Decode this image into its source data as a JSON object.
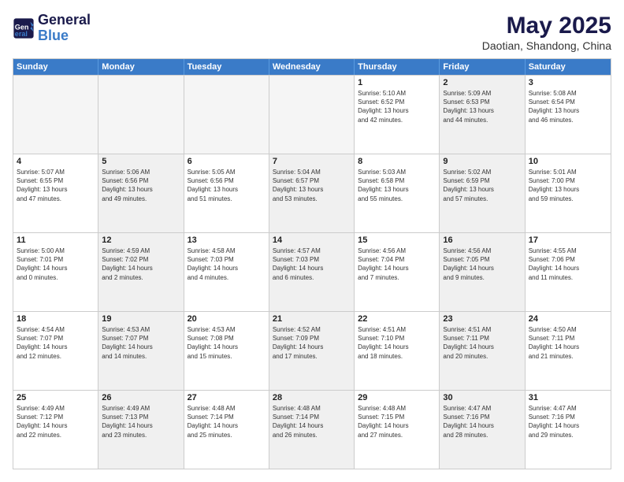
{
  "logo": {
    "line1": "General",
    "line2": "Blue"
  },
  "title": "May 2025",
  "subtitle": "Daotian, Shandong, China",
  "days": [
    "Sunday",
    "Monday",
    "Tuesday",
    "Wednesday",
    "Thursday",
    "Friday",
    "Saturday"
  ],
  "rows": [
    [
      {
        "day": "",
        "empty": true,
        "shaded": false
      },
      {
        "day": "",
        "empty": true,
        "shaded": false
      },
      {
        "day": "",
        "empty": true,
        "shaded": false
      },
      {
        "day": "",
        "empty": true,
        "shaded": false
      },
      {
        "day": "1",
        "empty": false,
        "shaded": false,
        "info": "Sunrise: 5:10 AM\nSunset: 6:52 PM\nDaylight: 13 hours\nand 42 minutes."
      },
      {
        "day": "2",
        "empty": false,
        "shaded": true,
        "info": "Sunrise: 5:09 AM\nSunset: 6:53 PM\nDaylight: 13 hours\nand 44 minutes."
      },
      {
        "day": "3",
        "empty": false,
        "shaded": false,
        "info": "Sunrise: 5:08 AM\nSunset: 6:54 PM\nDaylight: 13 hours\nand 46 minutes."
      }
    ],
    [
      {
        "day": "4",
        "empty": false,
        "shaded": false,
        "info": "Sunrise: 5:07 AM\nSunset: 6:55 PM\nDaylight: 13 hours\nand 47 minutes."
      },
      {
        "day": "5",
        "empty": false,
        "shaded": true,
        "info": "Sunrise: 5:06 AM\nSunset: 6:56 PM\nDaylight: 13 hours\nand 49 minutes."
      },
      {
        "day": "6",
        "empty": false,
        "shaded": false,
        "info": "Sunrise: 5:05 AM\nSunset: 6:56 PM\nDaylight: 13 hours\nand 51 minutes."
      },
      {
        "day": "7",
        "empty": false,
        "shaded": true,
        "info": "Sunrise: 5:04 AM\nSunset: 6:57 PM\nDaylight: 13 hours\nand 53 minutes."
      },
      {
        "day": "8",
        "empty": false,
        "shaded": false,
        "info": "Sunrise: 5:03 AM\nSunset: 6:58 PM\nDaylight: 13 hours\nand 55 minutes."
      },
      {
        "day": "9",
        "empty": false,
        "shaded": true,
        "info": "Sunrise: 5:02 AM\nSunset: 6:59 PM\nDaylight: 13 hours\nand 57 minutes."
      },
      {
        "day": "10",
        "empty": false,
        "shaded": false,
        "info": "Sunrise: 5:01 AM\nSunset: 7:00 PM\nDaylight: 13 hours\nand 59 minutes."
      }
    ],
    [
      {
        "day": "11",
        "empty": false,
        "shaded": false,
        "info": "Sunrise: 5:00 AM\nSunset: 7:01 PM\nDaylight: 14 hours\nand 0 minutes."
      },
      {
        "day": "12",
        "empty": false,
        "shaded": true,
        "info": "Sunrise: 4:59 AM\nSunset: 7:02 PM\nDaylight: 14 hours\nand 2 minutes."
      },
      {
        "day": "13",
        "empty": false,
        "shaded": false,
        "info": "Sunrise: 4:58 AM\nSunset: 7:03 PM\nDaylight: 14 hours\nand 4 minutes."
      },
      {
        "day": "14",
        "empty": false,
        "shaded": true,
        "info": "Sunrise: 4:57 AM\nSunset: 7:03 PM\nDaylight: 14 hours\nand 6 minutes."
      },
      {
        "day": "15",
        "empty": false,
        "shaded": false,
        "info": "Sunrise: 4:56 AM\nSunset: 7:04 PM\nDaylight: 14 hours\nand 7 minutes."
      },
      {
        "day": "16",
        "empty": false,
        "shaded": true,
        "info": "Sunrise: 4:56 AM\nSunset: 7:05 PM\nDaylight: 14 hours\nand 9 minutes."
      },
      {
        "day": "17",
        "empty": false,
        "shaded": false,
        "info": "Sunrise: 4:55 AM\nSunset: 7:06 PM\nDaylight: 14 hours\nand 11 minutes."
      }
    ],
    [
      {
        "day": "18",
        "empty": false,
        "shaded": false,
        "info": "Sunrise: 4:54 AM\nSunset: 7:07 PM\nDaylight: 14 hours\nand 12 minutes."
      },
      {
        "day": "19",
        "empty": false,
        "shaded": true,
        "info": "Sunrise: 4:53 AM\nSunset: 7:07 PM\nDaylight: 14 hours\nand 14 minutes."
      },
      {
        "day": "20",
        "empty": false,
        "shaded": false,
        "info": "Sunrise: 4:53 AM\nSunset: 7:08 PM\nDaylight: 14 hours\nand 15 minutes."
      },
      {
        "day": "21",
        "empty": false,
        "shaded": true,
        "info": "Sunrise: 4:52 AM\nSunset: 7:09 PM\nDaylight: 14 hours\nand 17 minutes."
      },
      {
        "day": "22",
        "empty": false,
        "shaded": false,
        "info": "Sunrise: 4:51 AM\nSunset: 7:10 PM\nDaylight: 14 hours\nand 18 minutes."
      },
      {
        "day": "23",
        "empty": false,
        "shaded": true,
        "info": "Sunrise: 4:51 AM\nSunset: 7:11 PM\nDaylight: 14 hours\nand 20 minutes."
      },
      {
        "day": "24",
        "empty": false,
        "shaded": false,
        "info": "Sunrise: 4:50 AM\nSunset: 7:11 PM\nDaylight: 14 hours\nand 21 minutes."
      }
    ],
    [
      {
        "day": "25",
        "empty": false,
        "shaded": false,
        "info": "Sunrise: 4:49 AM\nSunset: 7:12 PM\nDaylight: 14 hours\nand 22 minutes."
      },
      {
        "day": "26",
        "empty": false,
        "shaded": true,
        "info": "Sunrise: 4:49 AM\nSunset: 7:13 PM\nDaylight: 14 hours\nand 23 minutes."
      },
      {
        "day": "27",
        "empty": false,
        "shaded": false,
        "info": "Sunrise: 4:48 AM\nSunset: 7:14 PM\nDaylight: 14 hours\nand 25 minutes."
      },
      {
        "day": "28",
        "empty": false,
        "shaded": true,
        "info": "Sunrise: 4:48 AM\nSunset: 7:14 PM\nDaylight: 14 hours\nand 26 minutes."
      },
      {
        "day": "29",
        "empty": false,
        "shaded": false,
        "info": "Sunrise: 4:48 AM\nSunset: 7:15 PM\nDaylight: 14 hours\nand 27 minutes."
      },
      {
        "day": "30",
        "empty": false,
        "shaded": true,
        "info": "Sunrise: 4:47 AM\nSunset: 7:16 PM\nDaylight: 14 hours\nand 28 minutes."
      },
      {
        "day": "31",
        "empty": false,
        "shaded": false,
        "info": "Sunrise: 4:47 AM\nSunset: 7:16 PM\nDaylight: 14 hours\nand 29 minutes."
      }
    ]
  ]
}
